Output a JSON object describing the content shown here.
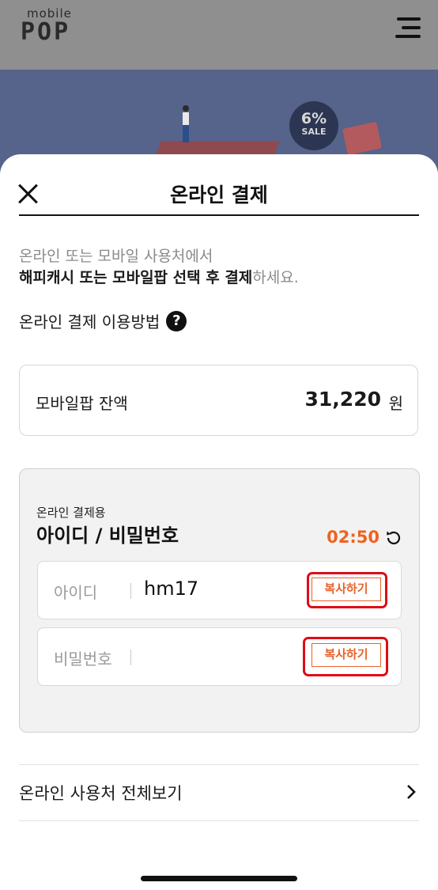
{
  "app": {
    "logo_small": "mobile",
    "logo_big": "POP"
  },
  "banner": {
    "sale_percent": "6%",
    "sale_label": "SALE"
  },
  "modal": {
    "title": "온라인 결제",
    "desc_line1": "온라인 또는 모바일 사용처에서",
    "desc_line2_strong": "해피캐시 또는 모바일팝 선택 후 결제",
    "desc_line2_tail": "하세요.",
    "howto_label": "온라인 결제 이용방법",
    "help_glyph": "?"
  },
  "balance": {
    "label": "모바일팝 잔액",
    "value": "31,220",
    "unit": "원"
  },
  "credentials": {
    "subtitle": "온라인 결제용",
    "title": "아이디 / 비밀번호",
    "timer": "02:50",
    "id_label": "아이디",
    "id_value": "hm17",
    "pw_label": "비밀번호",
    "pw_value": "",
    "copy_label": "복사하기"
  },
  "footer": {
    "all_places_label": "온라인 사용처 전체보기"
  },
  "colors": {
    "accent": "#f0621f",
    "highlight": "#e00b16"
  }
}
